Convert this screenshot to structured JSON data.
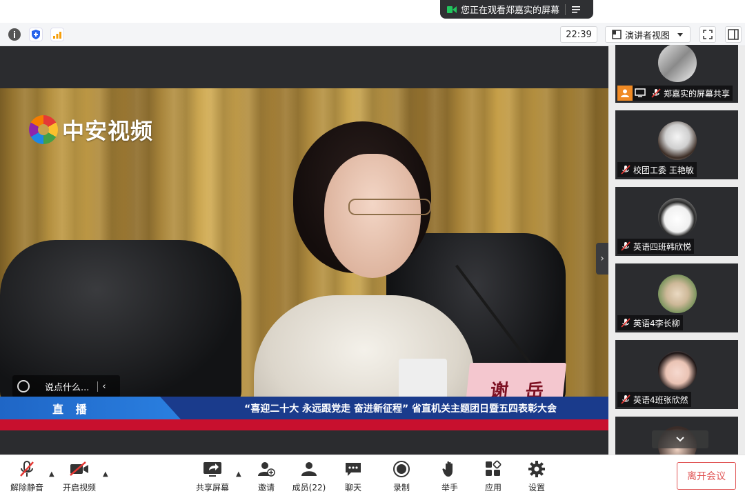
{
  "banner": {
    "sharing_text": "您正在观看郑嘉实的屏幕"
  },
  "toolbar": {
    "clock": "22:39",
    "view_mode": "演讲者视图"
  },
  "video": {
    "logo_text": "中安视频",
    "comment_placeholder": "说点什么...",
    "live_label": "直 播",
    "headline": "“喜迎二十大 永远跟党走 奋进新征程” 省直机关主题团日暨五四表彰大会",
    "nameplate": "谢 岳"
  },
  "participants": [
    {
      "name": "郑嘉实的屏幕共享",
      "sharing": true
    },
    {
      "name": "校团工委 王艳敏",
      "sharing": false
    },
    {
      "name": "英语四班韩欣悦",
      "sharing": false
    },
    {
      "name": "英语4李长柳",
      "sharing": false
    },
    {
      "name": "英语4班张欣然",
      "sharing": false
    }
  ],
  "controls": {
    "unmute": "解除静音",
    "video": "开启视频",
    "share": "共享屏幕",
    "invite": "邀请",
    "members": "成员(22)",
    "chat": "聊天",
    "record": "录制",
    "raise_hand": "举手",
    "apps": "应用",
    "settings": "设置",
    "leave": "离开会议"
  },
  "colors": {
    "leave": "#e05252",
    "share_badge": "#f08a24",
    "ticker_blue": "#1a3b8c",
    "ticker_red": "#c8102e"
  }
}
